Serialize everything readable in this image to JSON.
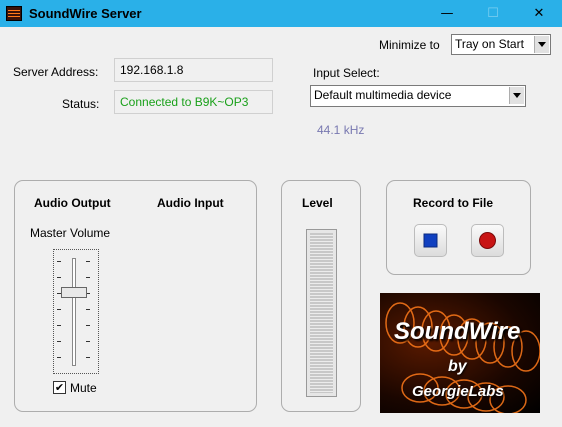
{
  "window": {
    "title": "SoundWire Server",
    "minimize_glyph": "—",
    "maximize_glyph": "☐",
    "close_glyph": "✕"
  },
  "top": {
    "minimize_label": "Minimize to",
    "minimize_option": "Tray on Start",
    "server_address_label": "Server Address:",
    "server_address_value": "192.168.1.8",
    "status_label": "Status:",
    "status_value": "Connected to B9K~OP3",
    "input_select_label": "Input Select:",
    "input_select_value": "Default multimedia device",
    "sample_rate": "44.1 kHz"
  },
  "audio": {
    "output_title": "Audio Output",
    "input_title": "Audio Input",
    "master_volume_label": "Master Volume",
    "mute_label": "Mute",
    "mute_checked": true,
    "check_glyph": "✔"
  },
  "level": {
    "title": "Level"
  },
  "record": {
    "title": "Record to File"
  },
  "logo": {
    "brand": "SoundWire",
    "by": "by",
    "maker": "GeorgieLabs"
  },
  "colors": {
    "titlebar": "#2ab0e8",
    "status_text": "#1aa01a",
    "sample_rate_text": "#7878b0",
    "stop_icon": "#1040c0",
    "record_icon": "#c81414"
  }
}
